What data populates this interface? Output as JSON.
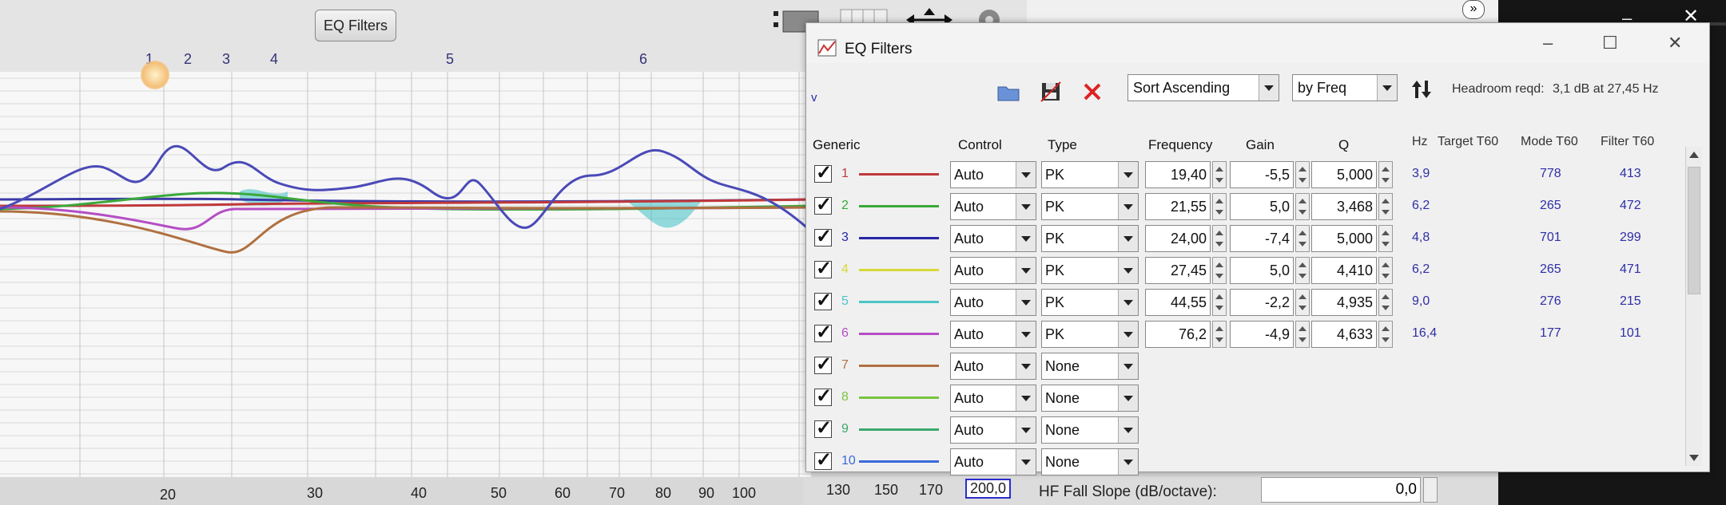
{
  "background": {
    "eq_filters_button": "EQ Filters",
    "filter_markers": [
      {
        "label": "1"
      },
      {
        "label": "2"
      },
      {
        "label": "3"
      },
      {
        "label": "4"
      },
      {
        "label": "5"
      },
      {
        "label": "6"
      }
    ],
    "x_axis_ticks": [
      "20",
      "30",
      "40",
      "50",
      "60",
      "70",
      "80",
      "90",
      "100",
      "130",
      "150",
      "170",
      "200,0"
    ],
    "hf_fall_slope_label": "HF Fall Slope (dB/octave):",
    "hf_fall_slope_value": "0,0"
  },
  "dialog": {
    "title": "EQ Filters",
    "collapse_marker": "v",
    "sort_option": "Sort Ascending",
    "sort_by": "by Freq",
    "headroom_label": "Headroom reqd:",
    "headroom_value": "3,1 dB at 27,45 Hz",
    "headers": {
      "generic": "Generic",
      "control": "Control",
      "type": "Type",
      "frequency": "Frequency",
      "gain": "Gain",
      "q": "Q",
      "hz": "Hz",
      "target_t60": "Target T60",
      "mode_t60": "Mode T60",
      "filter_t60": "Filter T60"
    },
    "filters": [
      {
        "idx": "1",
        "color": "#c0393b",
        "control": "Auto",
        "type": "PK",
        "frequency": "19,40",
        "gain": "-5,5",
        "q": "5,000",
        "hz": "3,9",
        "target": "778",
        "mode": "413"
      },
      {
        "idx": "2",
        "color": "#3aa83a",
        "control": "Auto",
        "type": "PK",
        "frequency": "21,55",
        "gain": "5,0",
        "q": "3,468",
        "hz": "6,2",
        "target": "265",
        "mode": "472"
      },
      {
        "idx": "3",
        "color": "#2626a6",
        "control": "Auto",
        "type": "PK",
        "frequency": "24,00",
        "gain": "-7,4",
        "q": "5,000",
        "hz": "4,8",
        "target": "701",
        "mode": "299"
      },
      {
        "idx": "4",
        "color": "#d8d83a",
        "control": "Auto",
        "type": "PK",
        "frequency": "27,45",
        "gain": "5,0",
        "q": "4,410",
        "hz": "6,2",
        "target": "265",
        "mode": "471"
      },
      {
        "idx": "5",
        "color": "#4cc4c8",
        "control": "Auto",
        "type": "PK",
        "frequency": "44,55",
        "gain": "-2,2",
        "q": "4,935",
        "hz": "9,0",
        "target": "276",
        "mode": "215"
      },
      {
        "idx": "6",
        "color": "#b44ec4",
        "control": "Auto",
        "type": "PK",
        "frequency": "76,2",
        "gain": "-4,9",
        "q": "4,633",
        "hz": "16,4",
        "target": "177",
        "mode": "101"
      },
      {
        "idx": "7",
        "color": "#b07040",
        "control": "Auto",
        "type": "None",
        "frequency": "",
        "gain": "",
        "q": "",
        "hz": "",
        "target": "",
        "mode": ""
      },
      {
        "idx": "8",
        "color": "#7ac440",
        "control": "Auto",
        "type": "None",
        "frequency": "",
        "gain": "",
        "q": "",
        "hz": "",
        "target": "",
        "mode": ""
      },
      {
        "idx": "9",
        "color": "#3aa86a",
        "control": "Auto",
        "type": "None",
        "frequency": "",
        "gain": "",
        "q": "",
        "hz": "",
        "target": "",
        "mode": ""
      },
      {
        "idx": "10",
        "color": "#3a6ad8",
        "control": "Auto",
        "type": "None",
        "frequency": "",
        "gain": "",
        "q": "",
        "hz": "",
        "target": "",
        "mode": ""
      }
    ]
  }
}
